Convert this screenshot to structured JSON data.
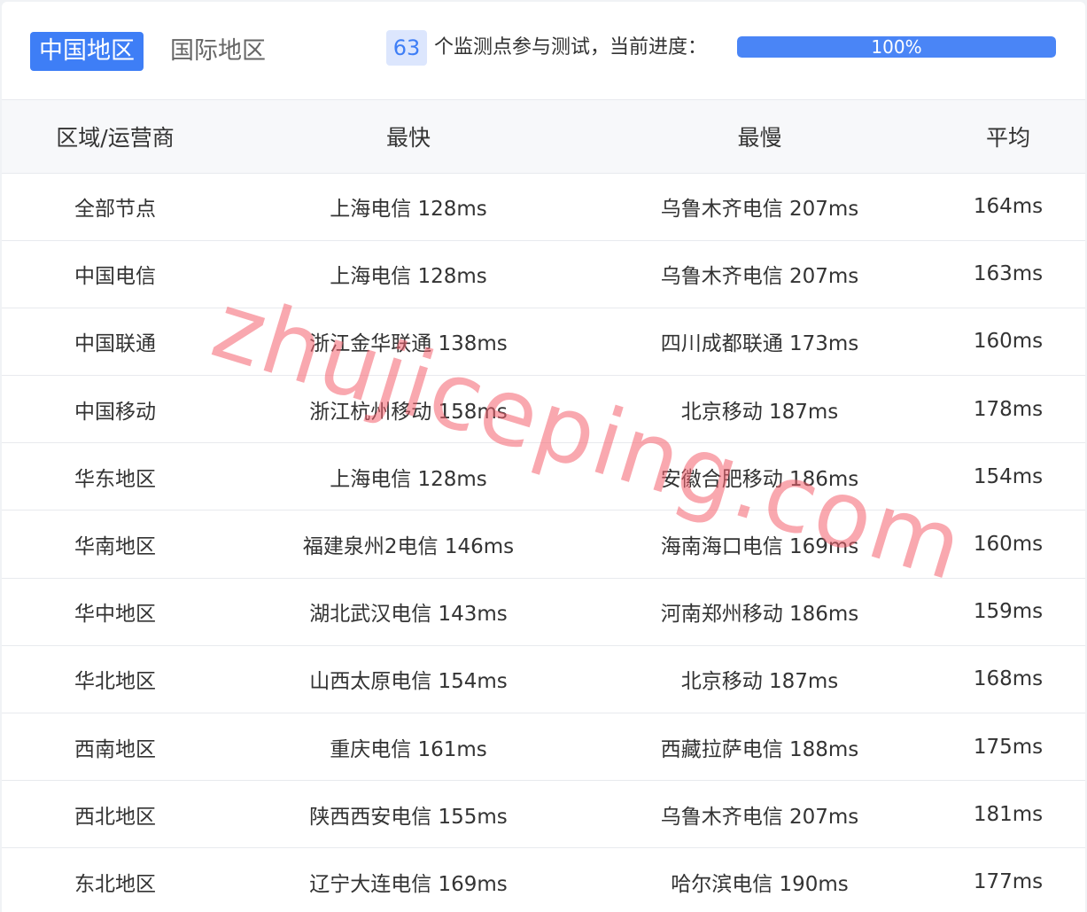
{
  "tabs": [
    {
      "label": "中国地区",
      "active": true
    },
    {
      "label": "国际地区",
      "active": false
    }
  ],
  "monitor": {
    "count": "63",
    "text": "个监测点参与测试，当前进度：",
    "progress_percent": 100,
    "progress_label": "100%"
  },
  "table": {
    "headers": [
      "区域/运营商",
      "最快",
      "最慢",
      "平均"
    ],
    "rows": [
      [
        "全部节点",
        "上海电信 128ms",
        "乌鲁木齐电信 207ms",
        "164ms"
      ],
      [
        "中国电信",
        "上海电信 128ms",
        "乌鲁木齐电信 207ms",
        "163ms"
      ],
      [
        "中国联通",
        "浙江金华联通 138ms",
        "四川成都联通 173ms",
        "160ms"
      ],
      [
        "中国移动",
        "浙江杭州移动 158ms",
        "北京移动 187ms",
        "178ms"
      ],
      [
        "华东地区",
        "上海电信 128ms",
        "安徽合肥移动 186ms",
        "154ms"
      ],
      [
        "华南地区",
        "福建泉州2电信 146ms",
        "海南海口电信 169ms",
        "160ms"
      ],
      [
        "华中地区",
        "湖北武汉电信 143ms",
        "河南郑州移动 186ms",
        "159ms"
      ],
      [
        "华北地区",
        "山西太原电信 154ms",
        "北京移动 187ms",
        "168ms"
      ],
      [
        "西南地区",
        "重庆电信 161ms",
        "西藏拉萨电信 188ms",
        "175ms"
      ],
      [
        "西北地区",
        "陕西西安电信 155ms",
        "乌鲁木齐电信 207ms",
        "181ms"
      ],
      [
        "东北地区",
        "辽宁大连电信 169ms",
        "哈尔滨电信 190ms",
        "177ms"
      ]
    ]
  },
  "watermark": "zhujiceping.com",
  "colors": {
    "accent": "#3e7ef6",
    "watermark": "#f4606e"
  }
}
